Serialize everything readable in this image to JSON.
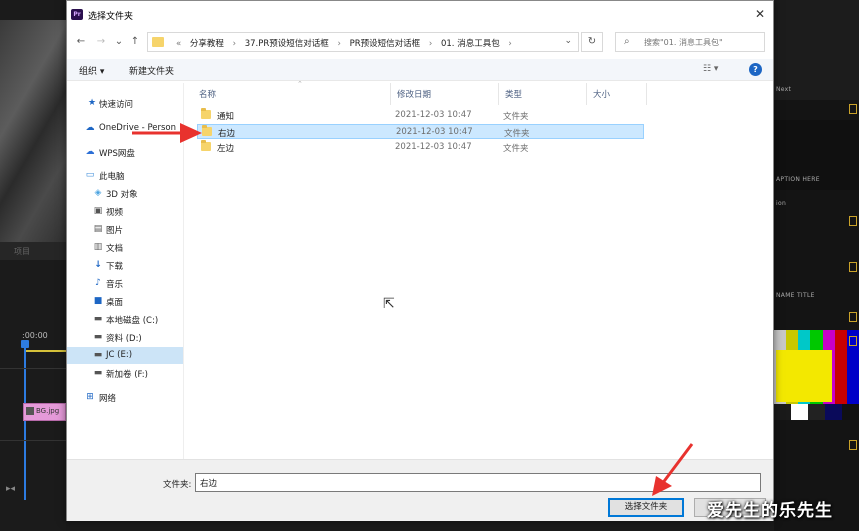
{
  "dialog": {
    "title": "选择文件夹",
    "app_icon": "Pr",
    "close": "✕"
  },
  "nav": {
    "back": "←",
    "forward": "→",
    "recent": "⌄",
    "up": "↑",
    "crumbs": [
      "«",
      "分享教程",
      "›",
      "37.PR预设短信对话框",
      "›",
      "PR预设短信对话框",
      "›",
      "01. 消息工具包",
      "›"
    ],
    "refresh": "↻",
    "search_placeholder": "搜索\"01. 消息工具包\""
  },
  "toolbar": {
    "organize": "组织 ▾",
    "new_folder": "新建文件夹",
    "view": "☷ ▾",
    "help": "?"
  },
  "sidebar": {
    "items": [
      {
        "label": "快速访问",
        "icon": "star-icon"
      },
      {
        "label": "OneDrive - Person",
        "icon": "cloud-icon"
      },
      {
        "label": "WPS网盘",
        "icon": "wps-cloud-icon"
      },
      {
        "label": "此电脑",
        "icon": "computer-icon"
      },
      {
        "label": "3D 对象",
        "icon": "cube-icon"
      },
      {
        "label": "视频",
        "icon": "video-icon"
      },
      {
        "label": "图片",
        "icon": "picture-icon"
      },
      {
        "label": "文档",
        "icon": "document-icon"
      },
      {
        "label": "下载",
        "icon": "download-icon"
      },
      {
        "label": "音乐",
        "icon": "music-icon"
      },
      {
        "label": "桌面",
        "icon": "desktop-icon"
      },
      {
        "label": "本地磁盘 (C:)",
        "icon": "drive-icon"
      },
      {
        "label": "资料 (D:)",
        "icon": "drive-icon"
      },
      {
        "label": "JC (E:)",
        "icon": "drive-icon"
      },
      {
        "label": "新加卷 (F:)",
        "icon": "drive-icon"
      },
      {
        "label": "网络",
        "icon": "network-icon"
      }
    ],
    "selected": "JC (E:)"
  },
  "columns": {
    "name": "名称",
    "date": "修改日期",
    "type": "类型",
    "size": "大小"
  },
  "files": [
    {
      "name": "通知",
      "date": "2021-12-03 10:47",
      "type": "文件夹"
    },
    {
      "name": "右边",
      "date": "2021-12-03 10:47",
      "type": "文件夹"
    },
    {
      "name": "左边",
      "date": "2021-12-03 10:47",
      "type": "文件夹"
    }
  ],
  "selected_file": "右边",
  "bottom": {
    "folder_label": "文件夹:",
    "folder_value": "右边",
    "select_button": "选择文件夹"
  },
  "background": {
    "left_tab": "项目",
    "timecode": ":00:00",
    "clip": "BG.jpg",
    "right_texts": [
      "Next",
      "APTION HERE",
      "ion",
      "NAME TITLE"
    ]
  },
  "watermark": "爱先生的乐先生",
  "colors": {
    "accent": "#0078d7",
    "selection": "#cce8ff",
    "folder": "#f6d46b",
    "annotation_arrow": "#e8322e"
  }
}
